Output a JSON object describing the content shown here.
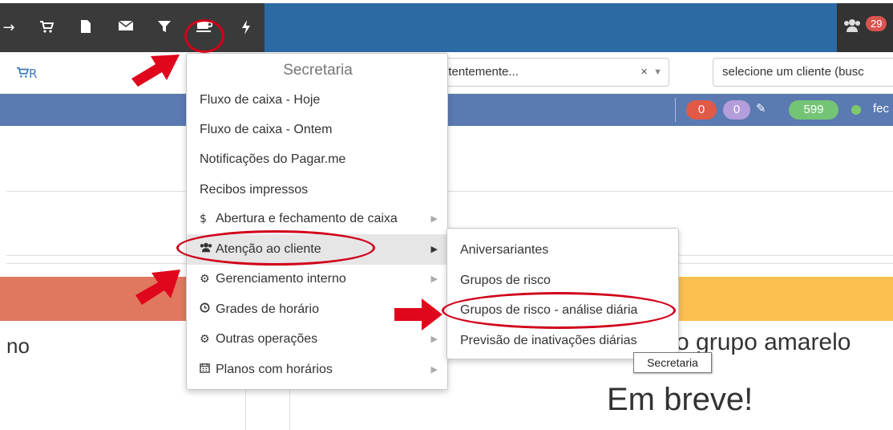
{
  "topnav": {
    "icons": [
      "login-icon",
      "cart-icon",
      "file-icon",
      "envelope-icon",
      "filter-icon",
      "coffee-icon",
      "bolt-icon"
    ],
    "users_count": "29"
  },
  "toolbar": {
    "cart_label": "R",
    "select_partial": "ntentemente...",
    "select_clear": "×",
    "client_placeholder": "selecione um cliente (busc"
  },
  "statusbar": {
    "red_count": "0",
    "purple_count": "0",
    "green_count": "599",
    "status_partial": "fec",
    "colors": {
      "red": "#e05a47",
      "purple": "#b39ddb",
      "green": "#74c476"
    }
  },
  "menu": {
    "header": "Secretaria",
    "items": [
      {
        "label": "Fluxo de caixa - Hoje",
        "icon": "",
        "submenu": false
      },
      {
        "label": "Fluxo de caixa - Ontem",
        "icon": "",
        "submenu": false
      },
      {
        "label": "Notificações do Pagar.me",
        "icon": "",
        "submenu": false
      },
      {
        "label": "Recibos impressos",
        "icon": "",
        "submenu": false
      },
      {
        "label": "Abertura e fechamento de caixa",
        "icon": "dollar-icon",
        "submenu": true
      },
      {
        "label": "Atenção ao cliente",
        "icon": "users-icon",
        "submenu": true
      },
      {
        "label": "Gerenciamento interno",
        "icon": "gears-icon",
        "submenu": true
      },
      {
        "label": "Grades de horário",
        "icon": "clock-icon",
        "submenu": false
      },
      {
        "label": "Outras operações",
        "icon": "gears-icon",
        "submenu": true
      },
      {
        "label": "Planos com horários",
        "icon": "calendar-icon",
        "submenu": true
      }
    ]
  },
  "submenu": {
    "items": [
      "Aniversariantes",
      "Grupos de risco",
      "Grupos de risco - análise diária",
      "Previsão de inativações diárias"
    ]
  },
  "tooltip": "Secretaria",
  "content": {
    "left_partial": "no",
    "right_partial": "o grupo amarelo",
    "em_breve": "Em breve!"
  },
  "annotation_color": "#d0021b"
}
